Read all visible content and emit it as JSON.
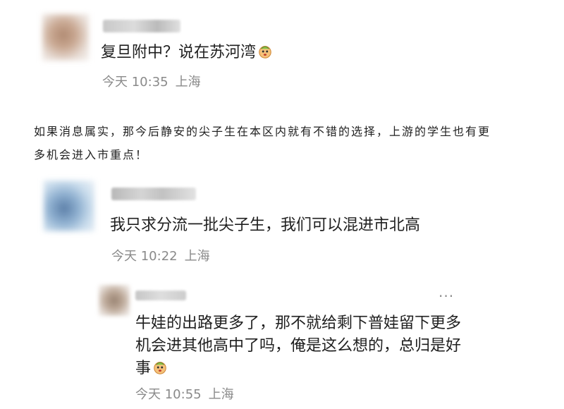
{
  "comments": [
    {
      "text": "复旦附中？说在苏河湾",
      "time": "今天 10:35",
      "location": "上海",
      "emoji": "ghost-face-emoji"
    },
    {
      "text": "我只求分流一批尖子生，我们可以混进市北高",
      "time": "今天 10:22",
      "location": "上海"
    },
    {
      "lines": [
        "牛娃的出路更多了，那不就给剩下普娃留下更多",
        "机会进其他高中了吗，俺是这么想的，总归是好",
        "事"
      ],
      "time": "今天 10:55",
      "location": "上海",
      "emoji": "ghost-face-emoji",
      "more": "···"
    }
  ],
  "post": {
    "line1": "如果消息属实，那今后静安的尖子生在本区内就有不错的选择，上游的学生也有更",
    "line2": "多机会进入市重点！"
  },
  "colors": {
    "meta": "#8a8a8a",
    "text": "#1f1f1f"
  }
}
